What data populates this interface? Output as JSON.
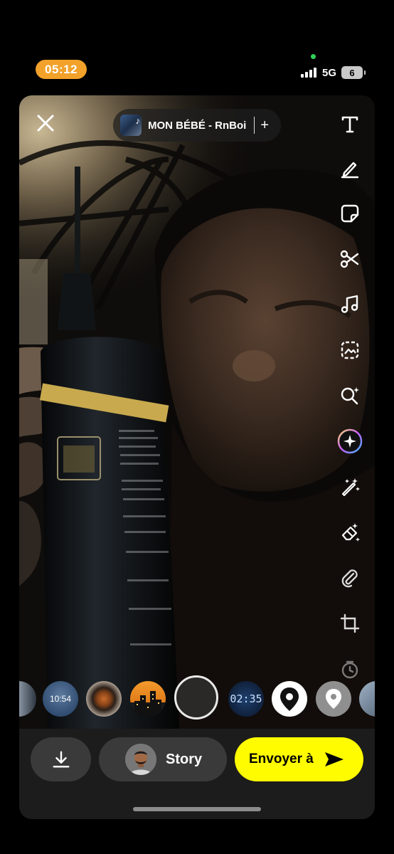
{
  "status_bar": {
    "time": "05:12",
    "network": "5G",
    "battery": "6"
  },
  "music": {
    "title": "MON BÉBÉ - RnBoi",
    "add_label": "+"
  },
  "tools": [
    "text-tool",
    "draw-tool",
    "sticker-tool",
    "scissors-tool",
    "music-tool",
    "scan-tool",
    "lens-search-tool",
    "ai-sparkle-tool",
    "magic-wand-tool",
    "eraser-tool",
    "attachment-tool",
    "crop-tool",
    "timer-tool"
  ],
  "lenses": [
    {
      "name": "lens-partial-left",
      "text": ""
    },
    {
      "name": "lens-time",
      "text": "10:54"
    },
    {
      "name": "lens-coffee",
      "text": ""
    },
    {
      "name": "lens-city",
      "text": ""
    },
    {
      "name": "lens-digital-clock",
      "text": "02:35"
    },
    {
      "name": "lens-location-pin",
      "text": ""
    },
    {
      "name": "lens-location-grey",
      "text": ""
    },
    {
      "name": "lens-partial-right",
      "text": ""
    }
  ],
  "bottom_bar": {
    "story_label": "Story",
    "send_label": "Envoyer à"
  },
  "colors": {
    "accent_yellow": "#fffc00",
    "status_orange": "#f2a12a",
    "bar_background": "#1c1c1c"
  }
}
